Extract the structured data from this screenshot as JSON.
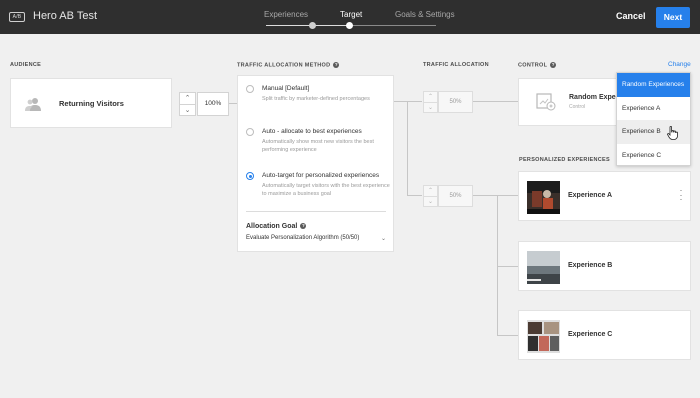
{
  "header": {
    "badge": "A/B",
    "title": "Hero AB Test",
    "steps": [
      {
        "label": "Experiences",
        "state": "done"
      },
      {
        "label": "Target",
        "state": "active"
      },
      {
        "label": "Goals & Settings",
        "state": "upcoming"
      }
    ],
    "cancel_label": "Cancel",
    "next_label": "Next"
  },
  "audience": {
    "heading": "AUDIENCE",
    "name": "Returning Visitors",
    "icon": "users-icon",
    "traffic_percent": "100%"
  },
  "method": {
    "heading": "TRAFFIC ALLOCATION METHOD",
    "options": [
      {
        "title": "Manual [Default]",
        "description": "Split traffic by marketer-defined percentages",
        "selected": false
      },
      {
        "title": "Auto - allocate to best experiences",
        "description": "Automatically show most new visitors the best performing experience",
        "selected": false
      },
      {
        "title": "Auto-target for personalized experiences",
        "description": "Automatically target visitors with the best experience to maximize a business goal",
        "selected": true
      }
    ],
    "goal_label": "Allocation Goal",
    "goal_value": "Evaluate Personalization Algorithm (50/50)"
  },
  "allocation": {
    "heading": "TRAFFIC ALLOCATION",
    "control_percent": "50%",
    "personalized_percent": "50%"
  },
  "control": {
    "heading": "CONTROL",
    "name": "Random Experiences",
    "sub": "Control",
    "change_label": "Change"
  },
  "dropdown": {
    "items": [
      {
        "label": "Random Experiences",
        "state": "selected"
      },
      {
        "label": "Experience A",
        "state": "normal"
      },
      {
        "label": "Experience B",
        "state": "hover"
      },
      {
        "label": "Experience C",
        "state": "normal"
      }
    ]
  },
  "personalized": {
    "heading": "PERSONALIZED EXPERIENCES",
    "experiences": [
      {
        "name": "Experience A"
      },
      {
        "name": "Experience B"
      },
      {
        "name": "Experience C"
      }
    ]
  },
  "colors": {
    "accent": "#2680eb",
    "header_bg": "#2f2f2f",
    "page_bg": "#f0f0f0"
  }
}
